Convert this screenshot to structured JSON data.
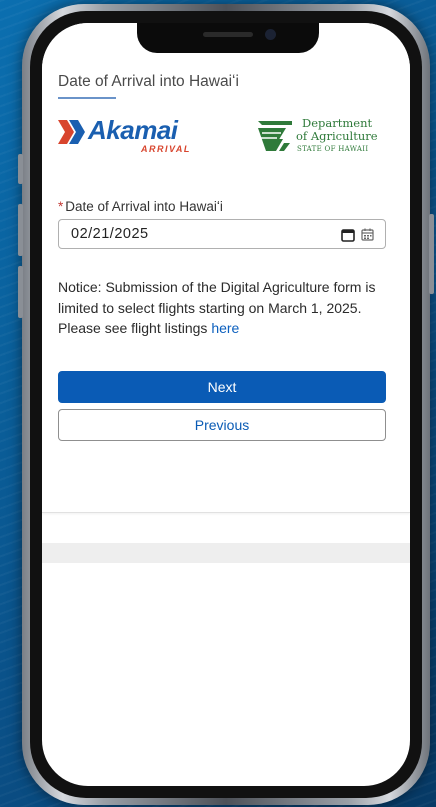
{
  "page": {
    "title": "Date of Arrival into Hawaiʻi"
  },
  "logos": {
    "akamai": {
      "word": "Akamai",
      "sub": "ARRIVAL",
      "word_color": "#1a5fb0",
      "sub_color": "#d8452e",
      "icon": "akamai-chevron-icon"
    },
    "doa": {
      "line1": "Department",
      "line2": "of Agriculture",
      "line3": "STATE OF HAWAII",
      "color": "#2f7a3a",
      "icon": "doa-emblem-icon"
    }
  },
  "form": {
    "required_marker": "*",
    "date_label": "Date of Arrival into Hawaiʻi",
    "date_value": "02/21/2025",
    "calendar_icon": "calendar-icon"
  },
  "notice": {
    "text": "Notice: Submission of the Digital Agriculture form is limited to select flights starting on March 1, 2025. Please see flight listings ",
    "link_text": "here"
  },
  "buttons": {
    "next_label": "Next",
    "previous_label": "Previous"
  },
  "colors": {
    "primary": "#0a5bb5",
    "required": "#c23934",
    "background": "#0b6fb0"
  }
}
